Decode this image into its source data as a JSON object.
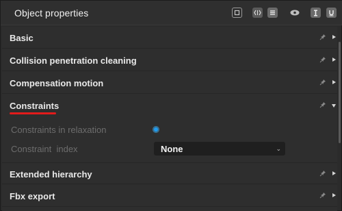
{
  "titlebar": {
    "title": "Object properties",
    "icons": [
      "frame-icon",
      "code-icon",
      "list-icon",
      "eye-icon",
      "text-cursor-icon",
      "underline-icon"
    ]
  },
  "sections": [
    {
      "label": "Basic",
      "expanded": false
    },
    {
      "label": "Collision penetration cleaning",
      "expanded": false
    },
    {
      "label": "Compensation motion",
      "expanded": false
    },
    {
      "label": "Constraints",
      "expanded": true
    },
    {
      "label": "Extended hierarchy",
      "expanded": false
    },
    {
      "label": "Fbx export",
      "expanded": false
    }
  ],
  "constraints": {
    "relaxation_label": "Constraints in relaxation",
    "relaxation_checked": true,
    "index_label": "Constraint  index",
    "index_value": "None"
  },
  "colors": {
    "accent": "#1e9bf0",
    "highlight": "#e31b1b"
  }
}
